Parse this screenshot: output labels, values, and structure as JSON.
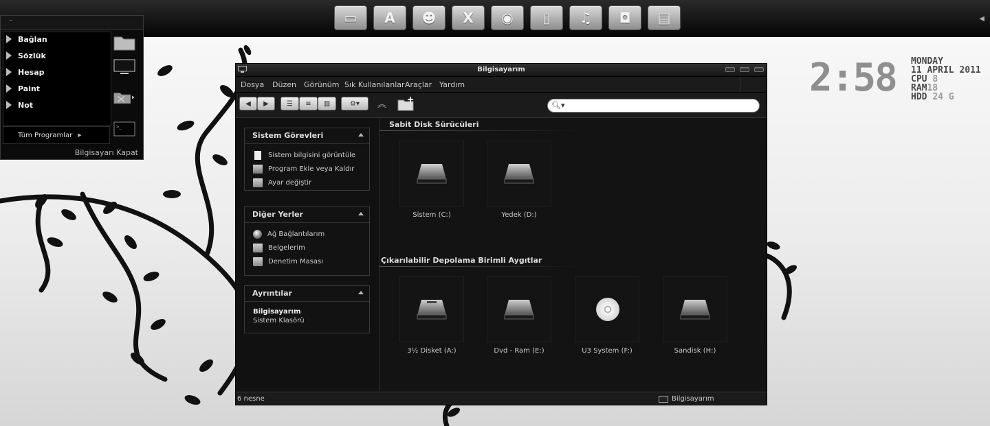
{
  "dock": {
    "icons": [
      {
        "icon": "window-icon",
        "glyph": "▭"
      },
      {
        "icon": "app-store-icon",
        "glyph": "A"
      },
      {
        "icon": "users-icon",
        "glyph": "☻"
      },
      {
        "icon": "close-x-icon",
        "glyph": "X"
      },
      {
        "icon": "firefox-icon",
        "glyph": "◉"
      },
      {
        "icon": "document-icon",
        "glyph": "▯"
      },
      {
        "icon": "music-icon",
        "glyph": "♫"
      },
      {
        "icon": "camera-icon",
        "glyph": "◘"
      },
      {
        "icon": "film-icon",
        "glyph": "▤"
      }
    ]
  },
  "start_menu": {
    "items": [
      {
        "label": "Bağlan"
      },
      {
        "label": "Sözlük"
      },
      {
        "label": "Hesap"
      },
      {
        "label": "Paint"
      },
      {
        "label": "Not"
      }
    ],
    "all_programs": "Tüm Programlar",
    "shutdown": "Bilgisayarı Kapat",
    "right_icons": [
      "folder-icon",
      "monitor-icon",
      "network-folder-icon",
      "terminal-icon"
    ]
  },
  "clock": {
    "time": "2:58",
    "day": "MONDAY",
    "date": "11 APRIL 2011",
    "cpu_label": "CPU",
    "cpu_value": "8",
    "ram_label": "RAM",
    "ram_value": "18",
    "hdd_label": "HDD",
    "hdd_value": "24 G"
  },
  "window": {
    "title": "Bilgisayarım",
    "menu": [
      "Dosya",
      "Düzen",
      "Görünüm",
      "Sık Kullanılanlar",
      "Araçlar",
      "Yardım"
    ],
    "search": {
      "value": "",
      "placeholder": ""
    },
    "task_pane": {
      "system_tasks": {
        "title": "Sistem Görevleri",
        "links": [
          {
            "label": "Sistem bilgisini görüntüle",
            "icon": "document-icon"
          },
          {
            "label": "Program Ekle veya Kaldır",
            "icon": "install-box-icon"
          },
          {
            "label": "Ayar değiştir",
            "icon": "folder-icon"
          }
        ]
      },
      "other_places": {
        "title": "Diğer Yerler",
        "links": [
          {
            "label": "Ağ Bağlantılarım",
            "icon": "globe-icon"
          },
          {
            "label": "Belgelerim",
            "icon": "folder-icon"
          },
          {
            "label": "Denetim Masası",
            "icon": "folder-icon"
          }
        ]
      },
      "details": {
        "title": "Ayrıntılar",
        "name": "Bilgisayarım",
        "type": "Sistem Klasörü"
      }
    },
    "groups": {
      "hard_disks": {
        "title": "Sabit Disk Sürücüleri",
        "drives": [
          {
            "label": "Sistem (C:)",
            "icon": "hard-drive-icon"
          },
          {
            "label": "Yedek (D:)",
            "icon": "hard-drive-icon"
          }
        ]
      },
      "removable": {
        "title": "Çıkarılabilir Depolama Birimli Aygıtlar",
        "drives": [
          {
            "label": "3½ Disket (A:)",
            "icon": "floppy-drive-icon"
          },
          {
            "label": "Dvd - Ram (E:)",
            "icon": "dvd-drive-icon"
          },
          {
            "label": "U3 System (F:)",
            "icon": "cd-icon"
          },
          {
            "label": "Sandisk (H:)",
            "icon": "usb-drive-icon"
          }
        ]
      }
    },
    "status": {
      "count": "6 nesne",
      "location": "Bilgisayarım"
    }
  }
}
